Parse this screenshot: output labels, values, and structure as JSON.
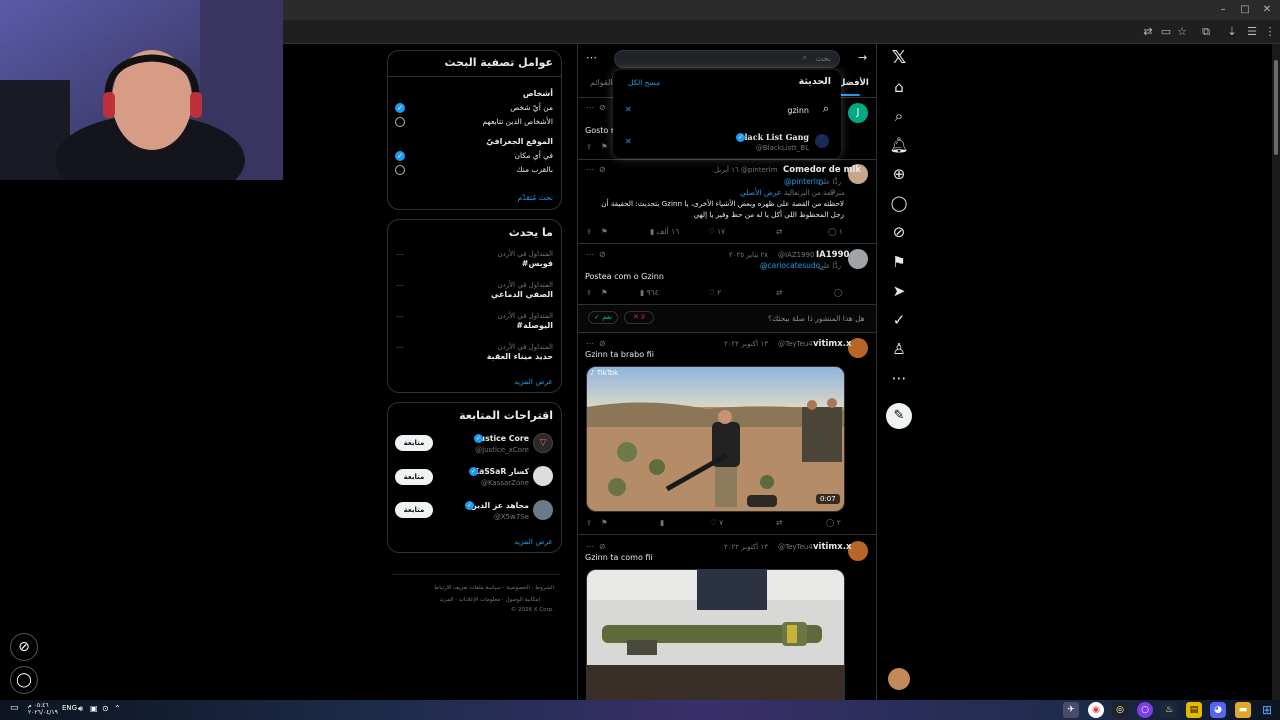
{
  "browser": {
    "window_controls": [
      "–",
      "□",
      "✕"
    ],
    "toolbar_icons": [
      "translate-icon",
      "cast-icon",
      "star-icon",
      "extensions-icon",
      "menu-icon"
    ]
  },
  "nav": {
    "logo": "𝕏",
    "items": [
      "home-icon",
      "search-icon",
      "bell-icon",
      "follow-icon",
      "messages-icon",
      "grok-icon",
      "bookmark-icon",
      "rocket-icon",
      "verified-icon",
      "profile-icon",
      "more-icon"
    ]
  },
  "search": {
    "placeholder": "بحث",
    "dropdown_title": "الحديثة",
    "clear_all": "مسح الكل",
    "recent_query": "gzinn",
    "recent_account_name": "Black List Gang",
    "recent_account_handle": "@BlackListt_BL"
  },
  "tabs": {
    "top": "الأفضل",
    "lists": "القوائم"
  },
  "feed": [
    {
      "text": "Gosto m",
      "actions": {
        "reply": "",
        "repost": "",
        "like": "",
        "views": ""
      }
    },
    {
      "name": "Comedor de mlk",
      "handle": "@pinterlm",
      "time": "١٦ أبريل",
      "reply_to": "ردًّا على",
      "reply_handle": "@pinterlm",
      "translated_note": "مترجمة من البرتغالية",
      "show_original": "عرض الأصلي",
      "text_line1": "بتحديث: الحقيقة أن Gzinn لاحظته من القصة على ظهره وبعض الأشياء الأخرى، يا",
      "text_line2": "رجل المحظوظ اللي أكل يا له من حظ وفير يا إلهي",
      "actions": {
        "reply": "١",
        "repost": "",
        "like": "١٧",
        "views": "١٦ ألف"
      }
    },
    {
      "name": "IA1990",
      "handle": "@IAZ1990",
      "time": "٢٨ يناير ٢٠٢٥",
      "reply_to": "ردًّا على",
      "reply_handle": "@cariocatesudo_",
      "text": "Postea com o Gzinn",
      "actions": {
        "reply": "",
        "repost": "",
        "like": "٢",
        "views": "٩٦٤"
      }
    },
    {
      "name": "vitimx.x",
      "handle": "@TeyTeu4",
      "time": "١٣ أكتوبر ٢٠٢٢",
      "text": "Gzinn ta brabo fii",
      "video_duration": "0:07",
      "watermark": "TikTok",
      "actions": {
        "reply": "٢",
        "repost": "",
        "like": "٧",
        "views": ""
      }
    },
    {
      "name": "vitimx.x",
      "handle": "@TeyTeu4",
      "time": "١٣ أكتوبر ٢٠٢٢",
      "text": "Gzinn ta como fii"
    }
  ],
  "relevance_prompt": {
    "question": "هل هذا المنشور ذا صلة ببحثك؟",
    "yes": "نعم",
    "no": "لا"
  },
  "filters": {
    "title": "عوامل تصفية البحث",
    "people_label": "أشخاص",
    "people_opt1": "من أيّ شخص",
    "people_opt2": "الأشخاص الذين تتابعهم",
    "location_label": "الموقع الجغرافيّ",
    "location_opt1": "في أي مكان",
    "location_opt2": "بالقرب منك",
    "advanced": "بحث مُتقدّم"
  },
  "trends": {
    "title": "ما يحدث",
    "items": [
      {
        "context": "المتداول في الأردن",
        "name": "#فوبس"
      },
      {
        "context": "المتداول في الأردن",
        "name": "الصفي الدماغي"
      },
      {
        "context": "المتداول في الأردن",
        "name": "#اليوصلة"
      },
      {
        "context": "المتداول في الأردن",
        "name": "حديد ميناء العقبة"
      }
    ],
    "show_more": "عرض المزيد"
  },
  "who_to_follow": {
    "title": "اقتراحات المتابعة",
    "follow_label": "متابعة",
    "accounts": [
      {
        "name": "Justice Core",
        "handle": "@Justice_xCore"
      },
      {
        "name": "KaSSaR كسار",
        "handle": "@KassarZone"
      },
      {
        "name": "مجاهد عز الدين",
        "handle": "@X5w7Se"
      }
    ],
    "show_more": "عرض المزيد"
  },
  "footer": {
    "line1": "الشروط · الخصوصية · سياسة ملفات تعريف الارتباط",
    "line2": "إمكانية الوصول · معلومات الإعلانات · المزيد",
    "line3": "© 2026 X Corp."
  },
  "taskbar": {
    "lang": "ENG",
    "time": "٠٥:٤٦ م",
    "date": "٢٠٢٦/٠٤/١٩"
  },
  "colors": {
    "accent": "#1d9bf0",
    "bg": "#000000",
    "border": "#2f3336"
  }
}
